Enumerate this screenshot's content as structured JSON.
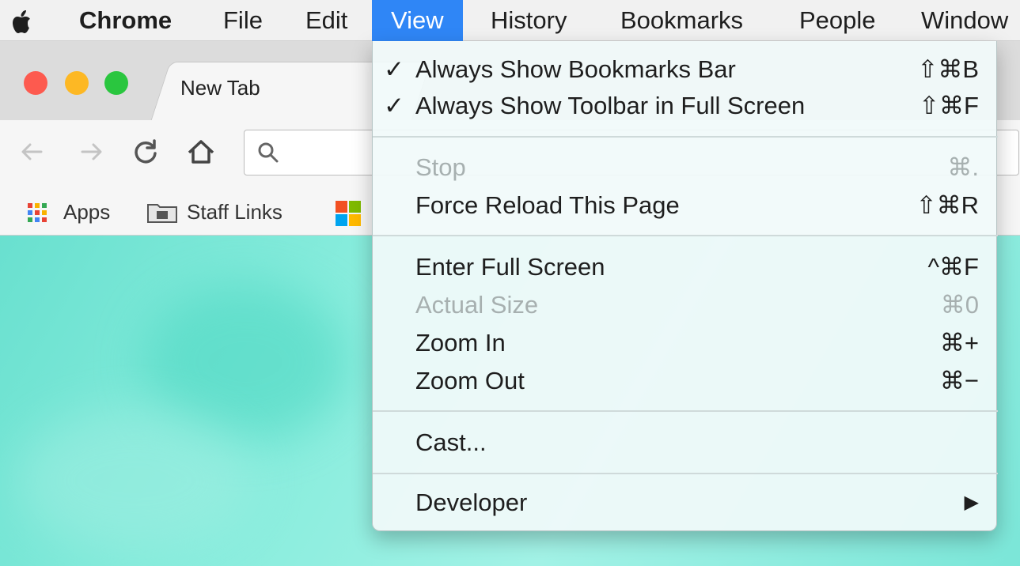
{
  "menubar": {
    "app": "Chrome",
    "items": [
      "File",
      "Edit",
      "View",
      "History",
      "Bookmarks",
      "People",
      "Window"
    ]
  },
  "browser": {
    "tab_title": "New Tab",
    "bookmarks": [
      "Apps",
      "Staff Links"
    ],
    "icons": [
      "back-arrow-icon",
      "forward-arrow-icon",
      "reload-icon",
      "home-icon",
      "search-icon"
    ]
  },
  "view_menu": {
    "section1": [
      {
        "check": "✓",
        "label": "Always Show Bookmarks Bar",
        "shortcut": "⇧⌘B"
      },
      {
        "check": "✓",
        "label": "Always Show Toolbar in Full Screen",
        "shortcut": "⇧⌘F"
      }
    ],
    "section2": [
      {
        "label": "Stop",
        "shortcut": "⌘.",
        "disabled": true
      },
      {
        "label": "Force Reload This Page",
        "shortcut": "⇧⌘R",
        "disabled": false
      }
    ],
    "section3": [
      {
        "label": "Enter Full Screen",
        "shortcut": "^⌘F",
        "disabled": false
      },
      {
        "label": "Actual Size",
        "shortcut": "⌘0",
        "disabled": true
      },
      {
        "label": "Zoom In",
        "shortcut": "⌘+",
        "disabled": false
      },
      {
        "label": "Zoom Out",
        "shortcut": "⌘−",
        "disabled": false
      }
    ],
    "section4": [
      {
        "label": "Cast...",
        "shortcut": ""
      }
    ],
    "section5": [
      {
        "label": "Developer",
        "shortcut": "▶"
      }
    ]
  },
  "colors": {
    "menubar_active": "#2f86f6",
    "traffic_red": "#fd5a4f",
    "traffic_yellow": "#fdb824",
    "traffic_green": "#2ac63f"
  }
}
